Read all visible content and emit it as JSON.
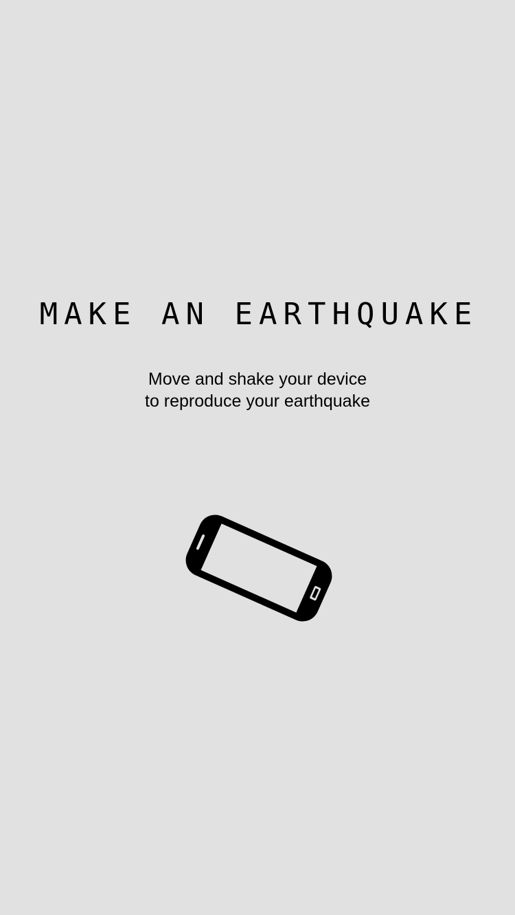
{
  "screen": {
    "background": "#e1e1e1",
    "title": "MAKE AN EARTHQUAKE",
    "instructions": {
      "line1": "Move and shake your device",
      "line2": "to reproduce your earthquake"
    },
    "illustration_icon": "tilted-smartphone-icon"
  }
}
